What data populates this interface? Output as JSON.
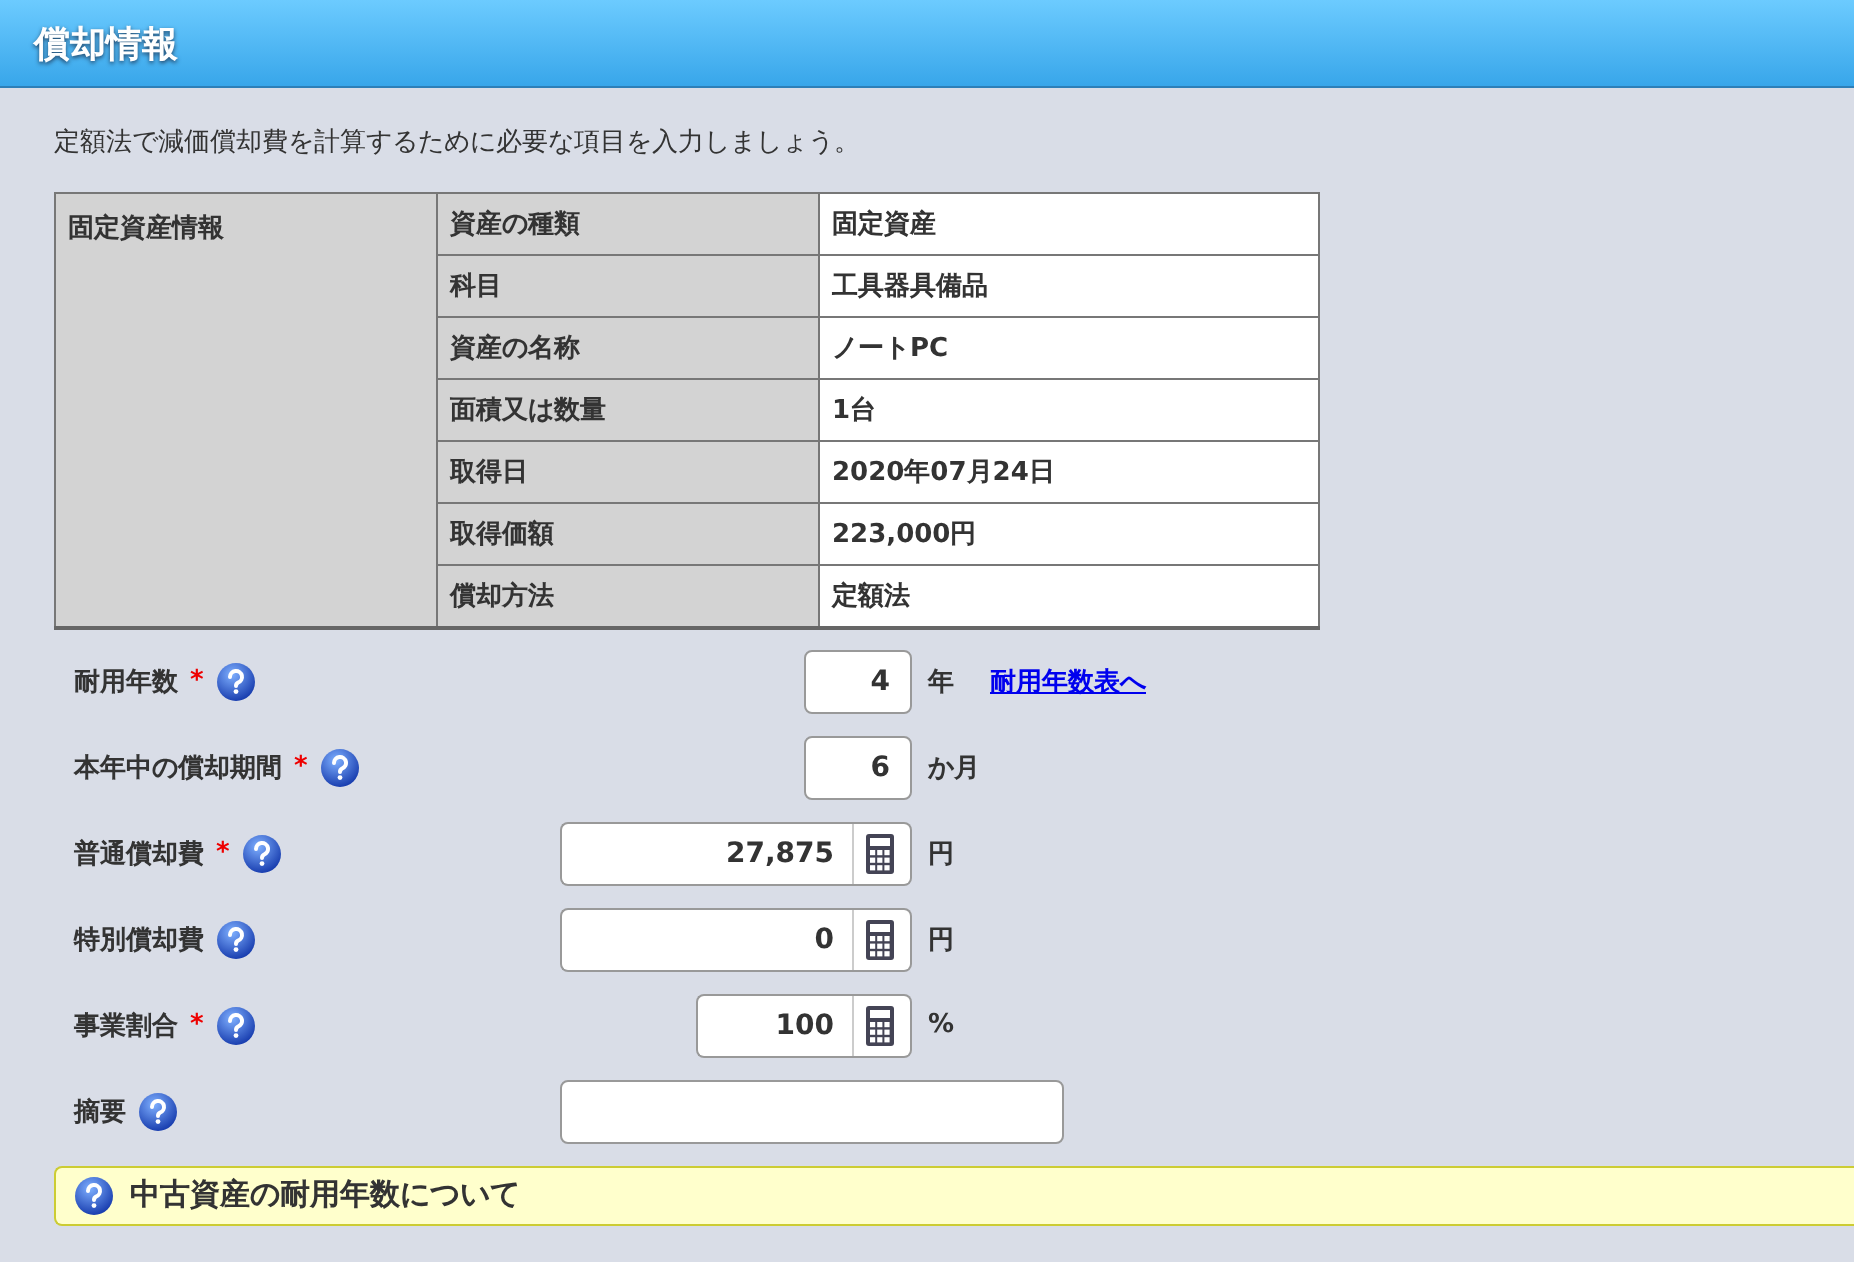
{
  "header": {
    "title": "償却情報"
  },
  "description": "定額法で減価償却費を計算するために必要な項目を入力しましょう。",
  "asset_table": {
    "group_label": "固定資産情報",
    "rows": [
      {
        "label": "資産の種類",
        "value": "固定資産"
      },
      {
        "label": "科目",
        "value": "工具器具備品"
      },
      {
        "label": "資産の名称",
        "value": "ノートPC"
      },
      {
        "label": "面積又は数量",
        "value": "1台"
      },
      {
        "label": "取得日",
        "value": "2020年07月24日"
      },
      {
        "label": "取得価額",
        "value": "223,000円"
      },
      {
        "label": "償却方法",
        "value": "定額法"
      }
    ]
  },
  "fields": [
    {
      "label": "耐用年数",
      "required_mark": "*",
      "kind": "short",
      "value": "4",
      "unit": "年",
      "link": "耐用年数表へ"
    },
    {
      "label": "本年中の償却期間",
      "required_mark": "*",
      "kind": "short",
      "value": "6",
      "unit": "か月"
    },
    {
      "label": "普通償却費",
      "required_mark": "*",
      "kind": "calc-wide",
      "value": "27,875",
      "unit": "円"
    },
    {
      "label": "特別償却費",
      "kind": "calc-wide",
      "value": "0",
      "unit": "円"
    },
    {
      "label": "事業割合",
      "required_mark": "*",
      "kind": "calc-narrow",
      "value": "100",
      "unit": "%"
    },
    {
      "label": "摘要",
      "kind": "text"
    }
  ],
  "help_panel": {
    "title": "中古資産の耐用年数について"
  }
}
